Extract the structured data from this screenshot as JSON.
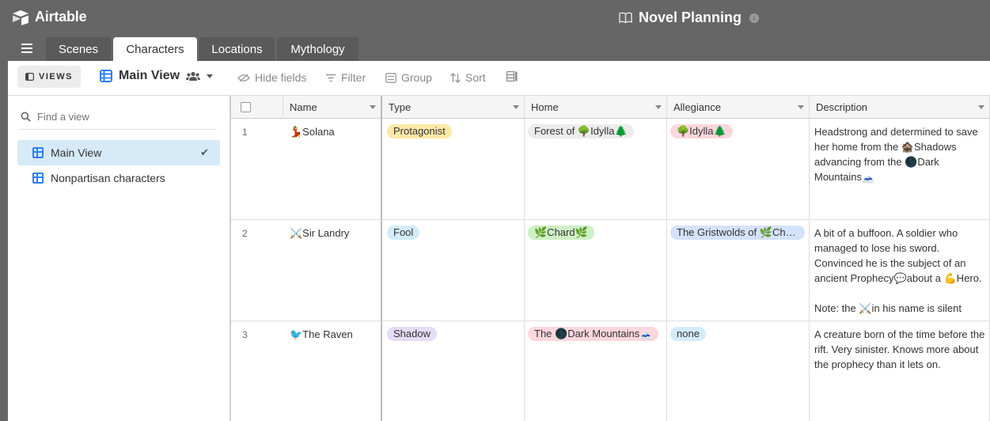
{
  "app": {
    "name": "Airtable",
    "base_title": "Novel Planning",
    "info": "i"
  },
  "tabs": [
    {
      "label": "Scenes",
      "active": false
    },
    {
      "label": "Characters",
      "active": true
    },
    {
      "label": "Locations",
      "active": false
    },
    {
      "label": "Mythology",
      "active": false
    }
  ],
  "toolbar": {
    "views_label": "VIEWS",
    "current_view": "Main View",
    "hide_fields": "Hide fields",
    "filter": "Filter",
    "group": "Group",
    "sort": "Sort"
  },
  "sidebar": {
    "search_placeholder": "Find a view",
    "views": [
      {
        "label": "Main View",
        "selected": true
      },
      {
        "label": "Nonpartisan characters",
        "selected": false
      }
    ]
  },
  "table": {
    "columns": [
      "Name",
      "Type",
      "Home",
      "Allegiance",
      "Description"
    ],
    "rows": [
      {
        "num": "1",
        "name": "💃Solana",
        "type": {
          "label": "Protagonist",
          "color": "#fde9a7"
        },
        "home": {
          "label": "Forest of 🌳Idylla🌲",
          "color": "#ececec"
        },
        "allegiance": {
          "label": "🌳Idylla🌲",
          "color": "#fcd7dd"
        },
        "description": "Headstrong and determined to save her home from the 🏚️Shadows advancing from the 🌑Dark Mountains🗻"
      },
      {
        "num": "2",
        "name": "⚔️Sir Landry",
        "type": {
          "label": "Fool",
          "color": "#d3ecfa"
        },
        "home": {
          "label": "🌿Chard🌿",
          "color": "#cfefc6"
        },
        "allegiance": {
          "label": "The Gristwolds of 🌿Chard🌿",
          "color": "#d4e2fb"
        },
        "description": "A bit of a buffoon. A soldier who managed to lose his sword. Convinced he is the subject of an ancient Prophecy💬about a 💪Hero.\n\nNote: the ⚔️in his name is silent"
      },
      {
        "num": "3",
        "name": "🐦The Raven",
        "type": {
          "label": "Shadow",
          "color": "#e6dcf7"
        },
        "home": {
          "label": "The 🌑Dark Mountains🗻",
          "color": "#fcd7dd"
        },
        "allegiance": {
          "label": "none",
          "color": "#d3ecfa"
        },
        "description": "A creature born of the time before the rift. Very sinister. Knows more about the prophecy than it lets on."
      }
    ]
  }
}
